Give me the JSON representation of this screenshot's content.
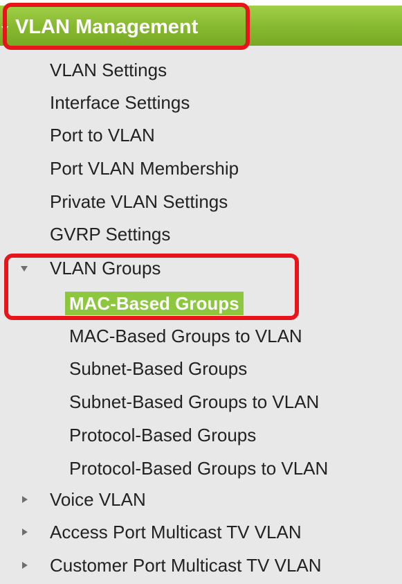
{
  "menu": {
    "header": {
      "label": "VLAN Management",
      "icon": "chevron-down-icon"
    },
    "items": [
      {
        "label": "VLAN Settings"
      },
      {
        "label": "Interface Settings"
      },
      {
        "label": "Port to VLAN"
      },
      {
        "label": "Port VLAN Membership"
      },
      {
        "label": "Private VLAN Settings"
      },
      {
        "label": "GVRP Settings"
      }
    ],
    "vlan_groups": {
      "label": "VLAN Groups",
      "expanded": true,
      "children": [
        {
          "label": "MAC-Based Groups",
          "selected": true
        },
        {
          "label": "MAC-Based Groups to VLAN"
        },
        {
          "label": "Subnet-Based Groups"
        },
        {
          "label": "Subnet-Based Groups to VLAN"
        },
        {
          "label": "Protocol-Based Groups"
        },
        {
          "label": "Protocol-Based Groups to VLAN"
        }
      ]
    },
    "collapsed_groups": [
      {
        "label": "Voice VLAN"
      },
      {
        "label": "Access Port Multicast TV VLAN"
      },
      {
        "label": "Customer Port Multicast TV VLAN"
      }
    ]
  },
  "colors": {
    "header_green": "#86b82f",
    "selected_green": "#8dc63f",
    "highlight_red": "#e8141b",
    "panel_gray": "#e8e8e8"
  }
}
